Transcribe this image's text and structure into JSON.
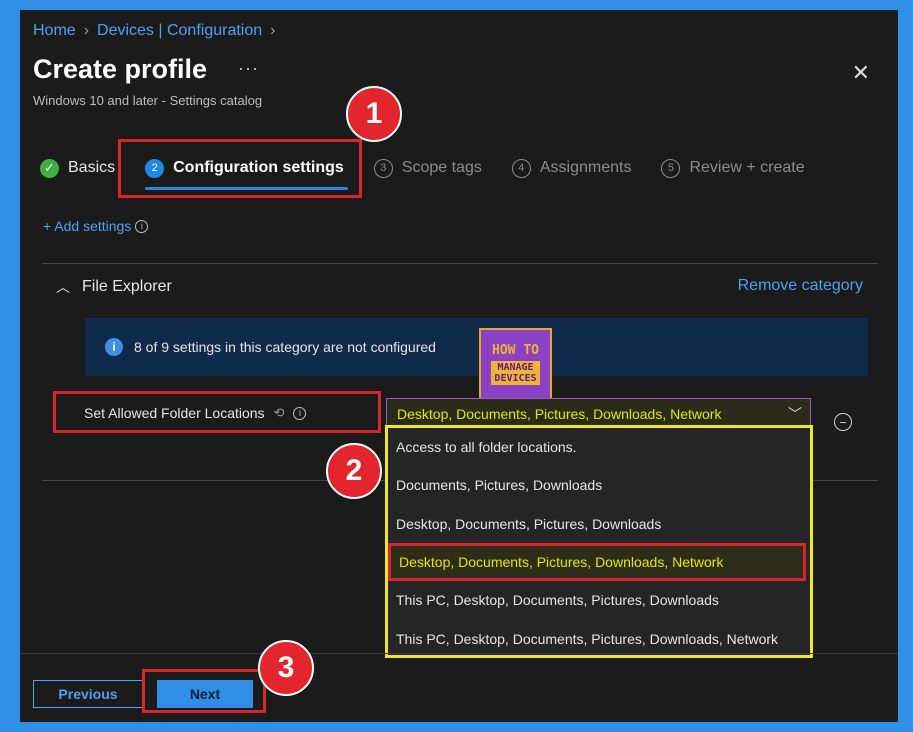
{
  "breadcrumb": {
    "home": "Home",
    "devices": "Devices | Configuration"
  },
  "header": {
    "title": "Create profile",
    "subtitle": "Windows 10 and later - Settings catalog",
    "more": "···",
    "close": "✕"
  },
  "steps": [
    {
      "num": "✓",
      "label": "Basics"
    },
    {
      "num": "2",
      "label": "Configuration settings"
    },
    {
      "num": "3",
      "label": "Scope tags"
    },
    {
      "num": "4",
      "label": "Assignments"
    },
    {
      "num": "5",
      "label": "Review + create"
    }
  ],
  "add_settings": "+ Add settings",
  "category": {
    "name": "File Explorer",
    "remove_label": "Remove category",
    "banner": "8 of 9 settings in this category are not configured"
  },
  "setting": {
    "label": "Set Allowed Folder Locations",
    "selected_value": "Desktop, Documents, Pictures, Downloads, Network",
    "options": [
      "Access to all folder locations.",
      "Documents, Pictures, Downloads",
      "Desktop, Documents, Pictures, Downloads",
      "Desktop, Documents, Pictures, Downloads, Network",
      "This PC, Desktop, Documents, Pictures, Downloads",
      "This PC, Desktop, Documents, Pictures, Downloads, Network"
    ]
  },
  "logo": {
    "line1": "HOW TO",
    "line2a": "MANAGE",
    "line2b": "DEVICES"
  },
  "callouts": [
    "1",
    "2",
    "3"
  ],
  "footer": {
    "previous": "Previous",
    "next": "Next"
  },
  "colors": {
    "accent": "#2f8fe6",
    "highlight_box": "#d8262e",
    "dropdown_outline": "#f1e52c",
    "selected_text": "#e6e600"
  }
}
